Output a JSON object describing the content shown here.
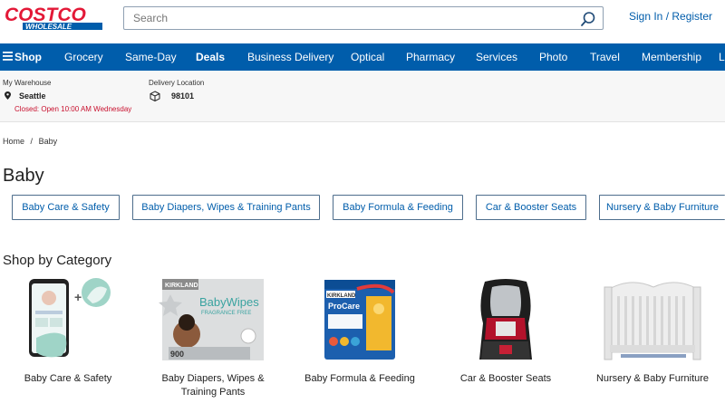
{
  "header": {
    "logo_text": "COSTCO",
    "logo_sub": "WHOLESALE",
    "search_placeholder": "Search",
    "signin_label": "Sign In / Register"
  },
  "nav": {
    "items": [
      "Shop",
      "Grocery",
      "Same-Day",
      "Deals",
      "Business Delivery",
      "Optical",
      "Pharmacy",
      "Services",
      "Photo",
      "Travel",
      "Membership",
      "L"
    ]
  },
  "location": {
    "warehouse_label": "My Warehouse",
    "warehouse_value": "Seattle",
    "warehouse_status": "Closed: Open 10:00 AM Wednesday",
    "delivery_label": "Delivery Location",
    "delivery_value": "98101"
  },
  "breadcrumb": [
    "Home",
    "/",
    "Baby"
  ],
  "page_title": "Baby",
  "chips": [
    "Baby Care & Safety",
    "Baby Diapers, Wipes & Training Pants",
    "Baby Formula & Feeding",
    "Car & Booster Seats",
    "Nursery & Baby Furniture"
  ],
  "section_title": "Shop by Category",
  "categories": [
    {
      "label": "Baby Care & Safety"
    },
    {
      "label": "Baby Diapers, Wipes &",
      "label2": "Training Pants",
      "brand": "KIRKLAND",
      "product": "BabyWipes",
      "sub": "FRAGRANCE FREE",
      "count": "900"
    },
    {
      "label": "Baby Formula & Feeding",
      "brand": "KIRKLAND",
      "product": "ProCare"
    },
    {
      "label": "Car & Booster Seats"
    },
    {
      "label": "Nursery & Baby Furniture"
    }
  ],
  "colors": {
    "brand_blue": "#005dab",
    "brand_red": "#e31837",
    "closed_red": "#c8102e"
  }
}
